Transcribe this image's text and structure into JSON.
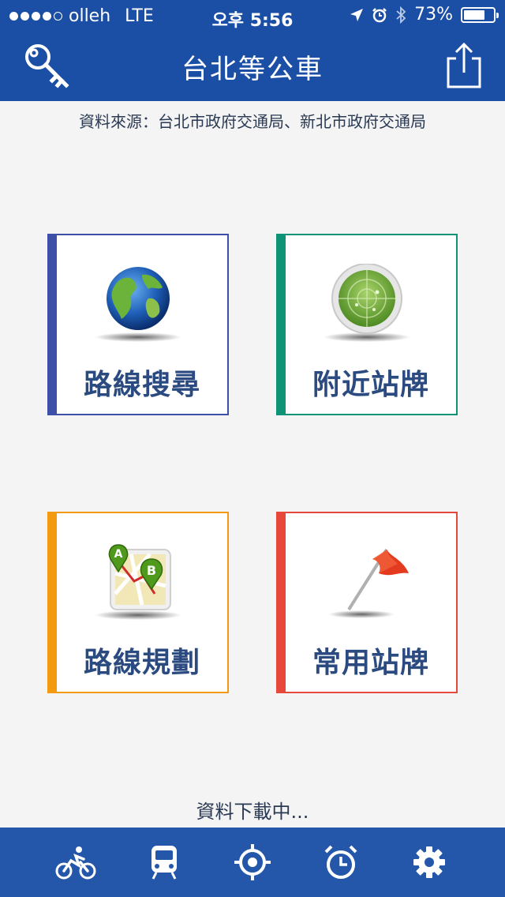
{
  "status_bar": {
    "carrier": "olleh",
    "network": "LTE",
    "time": "오후 5:56",
    "battery": "73%",
    "battery_level": 0.73
  },
  "nav": {
    "title": "台北等公車"
  },
  "source_text": "資料來源：台北市政府交通局、新北市政府交通局",
  "tiles": [
    {
      "label": "路線搜尋",
      "accent": "#3d4fa6",
      "icon": "globe-icon"
    },
    {
      "label": "附近站牌",
      "accent": "#0f9377",
      "icon": "radar-icon"
    },
    {
      "label": "路線規劃",
      "accent": "#f39a12",
      "icon": "map-route-icon"
    },
    {
      "label": "常用站牌",
      "accent": "#e6493c",
      "icon": "flag-icon"
    }
  ],
  "loading_text": "資料下載中...",
  "tabbar": {
    "icons": [
      "bicycle-icon",
      "train-icon",
      "locate-icon",
      "alarm-icon",
      "settings-icon"
    ]
  },
  "colors": {
    "brand": "#1b4ea5",
    "tabbar": "#2456aa",
    "background": "#f4f4f4"
  }
}
